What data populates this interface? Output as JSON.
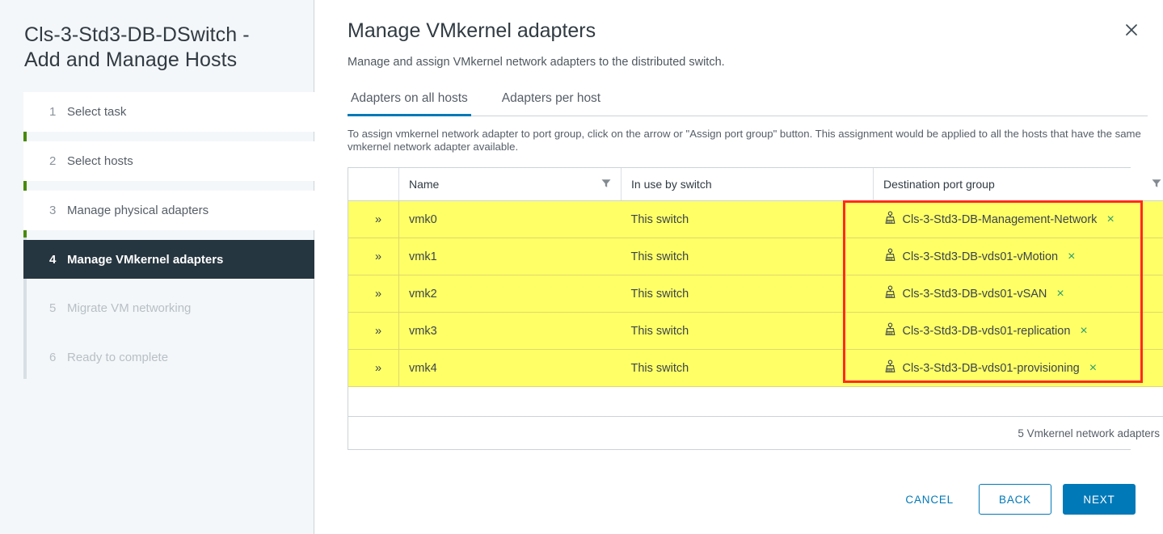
{
  "wizard": {
    "title": "Cls-3-Std3-DB-DSwitch - Add and Manage Hosts",
    "steps": [
      {
        "num": "1",
        "label": "Select task",
        "state": "done"
      },
      {
        "num": "2",
        "label": "Select hosts",
        "state": "done"
      },
      {
        "num": "3",
        "label": "Manage physical adapters",
        "state": "done"
      },
      {
        "num": "4",
        "label": "Manage VMkernel adapters",
        "state": "active"
      },
      {
        "num": "5",
        "label": "Migrate VM networking",
        "state": "future"
      },
      {
        "num": "6",
        "label": "Ready to complete",
        "state": "future"
      }
    ]
  },
  "page": {
    "title": "Manage VMkernel adapters",
    "subtitle": "Manage and assign VMkernel network adapters to the distributed switch.",
    "close_icon": "close-icon",
    "hint": "To assign vmkernel network adapter to port group, click on the arrow or \"Assign port group\" button. This assignment would be applied to all the hosts that have the same vmkernel network adapter available."
  },
  "tabs": [
    {
      "label": "Adapters on all hosts",
      "selected": true
    },
    {
      "label": "Adapters per host",
      "selected": false
    }
  ],
  "table": {
    "columns": {
      "expand": "",
      "name": "Name",
      "in_use": "In use by switch",
      "destination": "Destination port group"
    },
    "filter_icon": "filter-icon",
    "expand_icon": "chevron-double-right-icon",
    "portgroup_icon": "port-group-icon",
    "remove_icon": "remove-icon",
    "rows": [
      {
        "expand": "»",
        "name": "vmk0",
        "in_use": "This switch",
        "destination": "Cls-3-Std3-DB-Management-Network",
        "remove": "×"
      },
      {
        "expand": "»",
        "name": "vmk1",
        "in_use": "This switch",
        "destination": "Cls-3-Std3-DB-vds01-vMotion",
        "remove": "×"
      },
      {
        "expand": "»",
        "name": "vmk2",
        "in_use": "This switch",
        "destination": "Cls-3-Std3-DB-vds01-vSAN",
        "remove": "×"
      },
      {
        "expand": "»",
        "name": "vmk3",
        "in_use": "This switch",
        "destination": "Cls-3-Std3-DB-vds01-replication",
        "remove": "×"
      },
      {
        "expand": "»",
        "name": "vmk4",
        "in_use": "This switch",
        "destination": "Cls-3-Std3-DB-vds01-provisioning",
        "remove": "×"
      }
    ],
    "footer_count": "5 Vmkernel network adapters"
  },
  "buttons": {
    "cancel": "CANCEL",
    "back": "BACK",
    "next": "NEXT"
  },
  "colors": {
    "accent": "#0079b8",
    "highlight_row": "#ffff66",
    "highlight_box": "#ff2a20",
    "step_done": "#488a0c",
    "step_active_bg": "#263640",
    "remove_x": "#2a9d6e"
  }
}
